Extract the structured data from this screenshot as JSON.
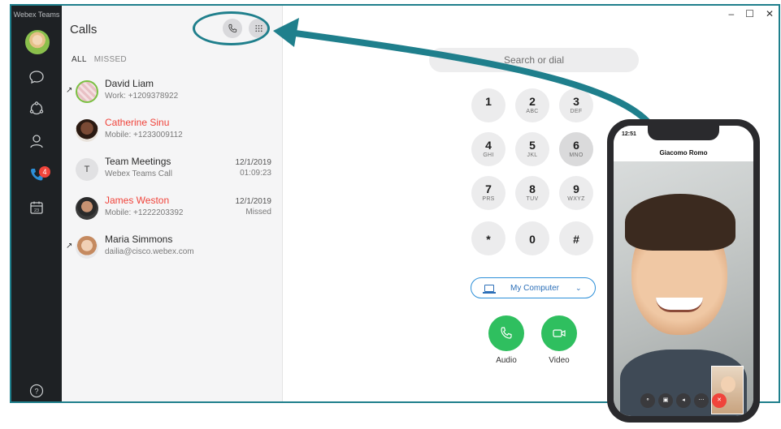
{
  "app": {
    "name": "Webex Teams"
  },
  "nav": {
    "calls_badge": "4"
  },
  "calls": {
    "title": "Calls",
    "filters": [
      "ALL",
      "MISSED"
    ],
    "rows": [
      {
        "name": "David Liam",
        "detail": "Work: +1209378922",
        "date": "",
        "time": "",
        "missed": false,
        "outgoing_marker": "↗"
      },
      {
        "name": "Catherine Sinu",
        "detail": "Mobile: +1233009112",
        "date": "",
        "time": "",
        "missed": true,
        "outgoing_marker": ""
      },
      {
        "name": "Team Meetings",
        "detail": "Webex Teams Call",
        "date": "12/1/2019",
        "time": "01:09:23",
        "missed": false,
        "outgoing_marker": "",
        "initial": "T"
      },
      {
        "name": "James Weston",
        "detail": "Mobile: +1222203392",
        "date": "12/1/2019",
        "time": "Missed",
        "missed": true,
        "outgoing_marker": ""
      },
      {
        "name": "Maria Simmons",
        "detail": "dailia@cisco.webex.com",
        "date": "",
        "time": "",
        "missed": false,
        "outgoing_marker": "↗"
      }
    ]
  },
  "dialer": {
    "search_placeholder": "Search or dial",
    "keys": [
      {
        "digit": "1",
        "letters": ""
      },
      {
        "digit": "2",
        "letters": "ABC"
      },
      {
        "digit": "3",
        "letters": "DEF"
      },
      {
        "digit": "4",
        "letters": "GHI"
      },
      {
        "digit": "5",
        "letters": "JKL"
      },
      {
        "digit": "6",
        "letters": "MNO"
      },
      {
        "digit": "7",
        "letters": "PRS"
      },
      {
        "digit": "8",
        "letters": "TUV"
      },
      {
        "digit": "9",
        "letters": "WXYZ"
      },
      {
        "digit": "*",
        "letters": ""
      },
      {
        "digit": "0",
        "letters": ""
      },
      {
        "digit": "#",
        "letters": ""
      }
    ],
    "device": "My Computer",
    "audio_label": "Audio",
    "video_label": "Video"
  },
  "window_controls": [
    "–",
    "☐",
    "✕"
  ],
  "phone": {
    "clock": "12:51",
    "caller": "Giacomo Romo"
  },
  "colors": {
    "accent": "#1f7f8c",
    "green": "#2fbf5f",
    "missed": "#f0443b",
    "rail": "#1e2124"
  }
}
